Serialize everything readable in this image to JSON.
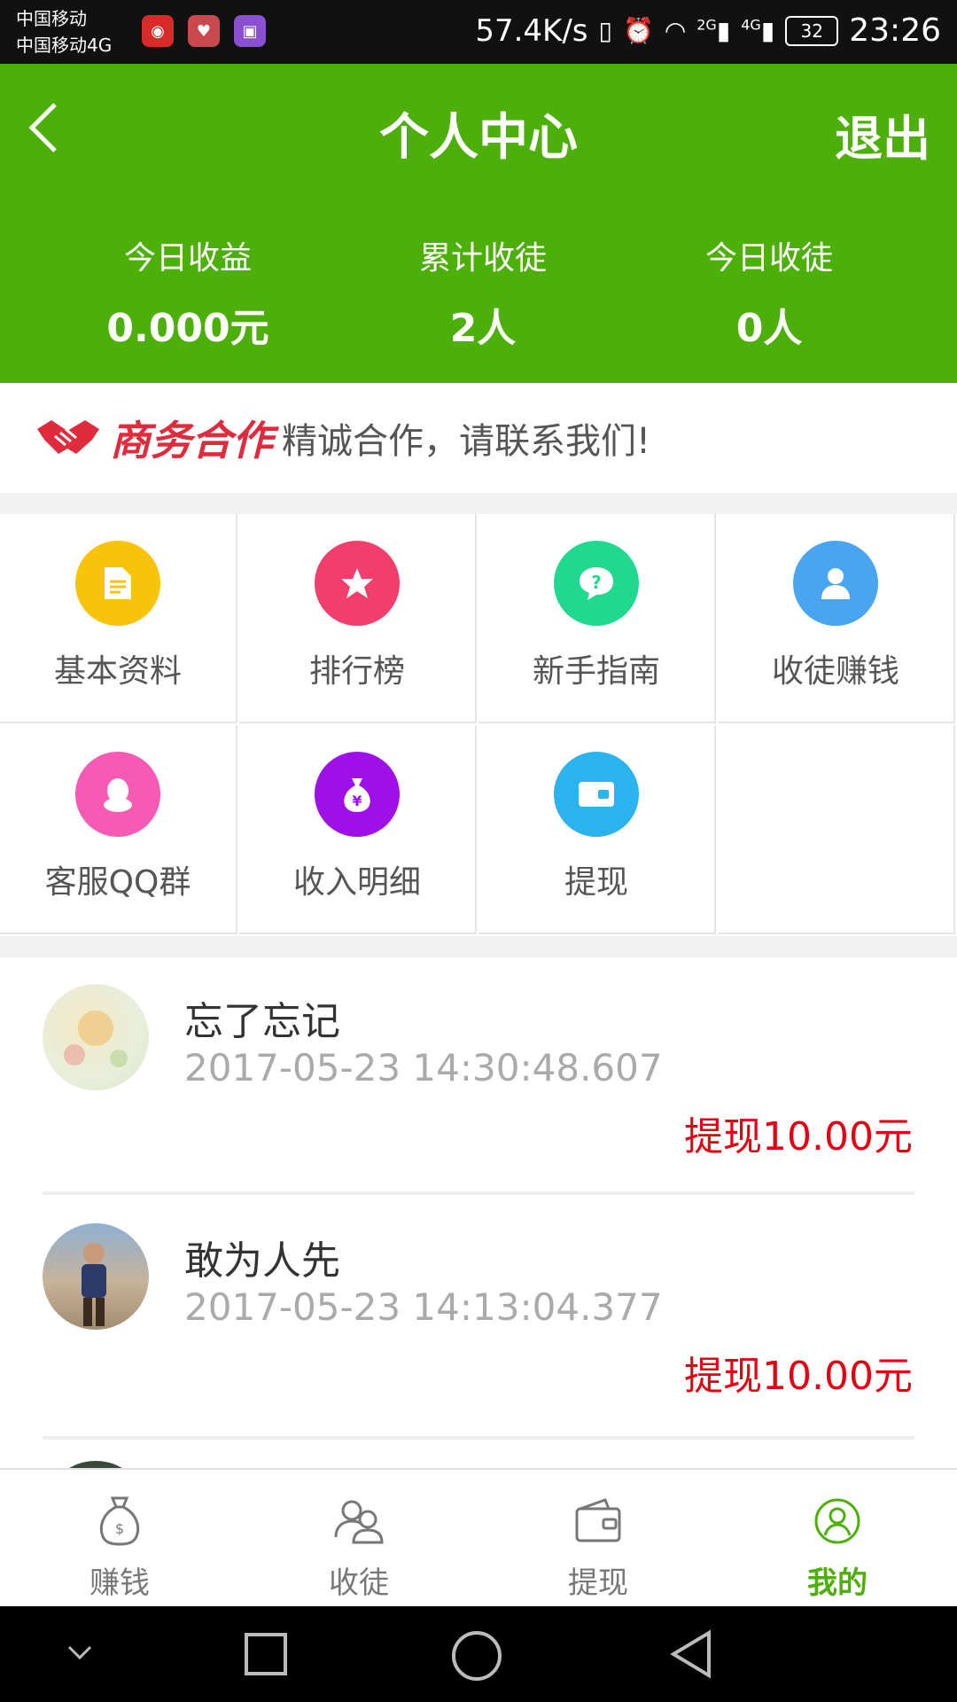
{
  "status_bar": {
    "carrier1": "中国移动",
    "carrier2": "中国移动4G",
    "speed": "57.4K/s",
    "battery": "32",
    "time": "23:26",
    "net1": "2G",
    "net2": "4G"
  },
  "header": {
    "title": "个人中心",
    "logout": "退出",
    "bg_color": "#4caf0a",
    "stats": [
      {
        "label": "今日收益",
        "value": "0.000元"
      },
      {
        "label": "累计收徒",
        "value": "2人"
      },
      {
        "label": "今日收徒",
        "value": "0人"
      }
    ]
  },
  "banner": {
    "brand": "商务合作",
    "text": "精诚合作，请联系我们!"
  },
  "menu": [
    {
      "label": "基本资料",
      "icon": "document-icon",
      "color": "#f9c30a"
    },
    {
      "label": "排行榜",
      "icon": "star-icon",
      "color": "#f23e6b"
    },
    {
      "label": "新手指南",
      "icon": "help-bubble-icon",
      "color": "#21d890"
    },
    {
      "label": "收徒赚钱",
      "icon": "person-icon",
      "color": "#4aa5f0"
    },
    {
      "label": "客服QQ群",
      "icon": "qq-penguin-icon",
      "color": "#f65ab5"
    },
    {
      "label": "收入明细",
      "icon": "money-bag-icon",
      "color": "#9f0fe8"
    },
    {
      "label": "提现",
      "icon": "wallet-icon",
      "color": "#2ab3ec"
    }
  ],
  "records": [
    {
      "name": "忘了忘记",
      "time": "2017-05-23 14:30:48.607",
      "amount": "提现10.00元"
    },
    {
      "name": "敢为人先",
      "time": "2017-05-23 14:13:04.377",
      "amount": "提现10.00元"
    }
  ],
  "tabs": [
    {
      "label": "赚钱",
      "icon": "money-bag-icon"
    },
    {
      "label": "收徒",
      "icon": "people-icon"
    },
    {
      "label": "提现",
      "icon": "wallet-icon"
    },
    {
      "label": "我的",
      "icon": "user-circle-icon",
      "active": true
    }
  ],
  "colors": {
    "accent": "#4caf0a",
    "amount": "#e60012",
    "brand": "#e02b3c"
  }
}
